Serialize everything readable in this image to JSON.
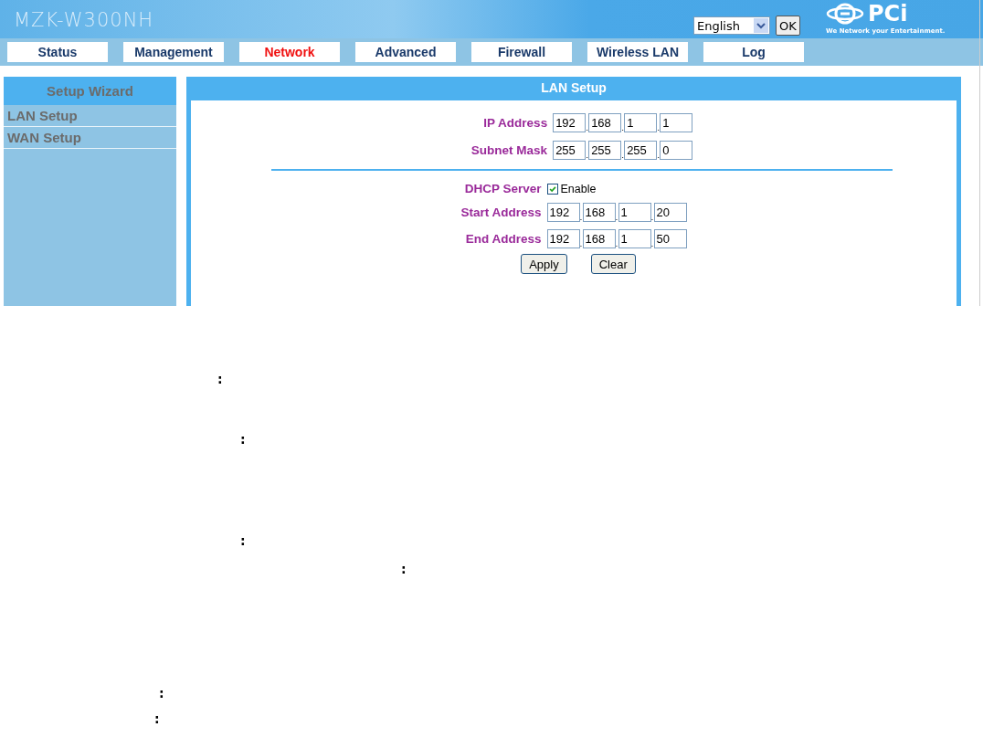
{
  "header": {
    "model": "MZK-W300NH",
    "language": {
      "value": "English"
    },
    "ok_button": "OK",
    "brand": {
      "name": "PCi",
      "slogan": "We Network your Entertainment."
    }
  },
  "nav": [
    {
      "label": "Status",
      "selected": false
    },
    {
      "label": "Management",
      "selected": false
    },
    {
      "label": "Network",
      "selected": true
    },
    {
      "label": "Advanced",
      "selected": false
    },
    {
      "label": "Firewall",
      "selected": false
    },
    {
      "label": "Wireless LAN",
      "selected": false
    },
    {
      "label": "Log",
      "selected": false
    }
  ],
  "sidebar": {
    "title": "Setup Wizard",
    "items": [
      {
        "label": "LAN Setup"
      },
      {
        "label": "WAN Setup"
      }
    ]
  },
  "panel": {
    "title": "LAN Setup",
    "lan": [
      {
        "label": "IP Address",
        "octets": [
          "192",
          "168",
          "1",
          "1"
        ],
        "separator": "."
      },
      {
        "label": "Subnet Mask",
        "octets": [
          "255",
          "255",
          "255",
          "0"
        ],
        "separator": "."
      }
    ],
    "dhcp": {
      "label": "DHCP Server",
      "checkbox_label": "Enable",
      "checked": true
    },
    "ranges": [
      {
        "label": "Start Address",
        "octets": [
          "192",
          "168",
          "1",
          "20"
        ],
        "separator": "."
      },
      {
        "label": "End Address",
        "octets": [
          "192",
          "168",
          "1",
          "50"
        ],
        "separator": "."
      }
    ],
    "buttons": [
      "Apply",
      "Clear"
    ]
  },
  "stray_marks": [
    ":",
    ":",
    ":",
    ":",
    ":",
    ":"
  ]
}
